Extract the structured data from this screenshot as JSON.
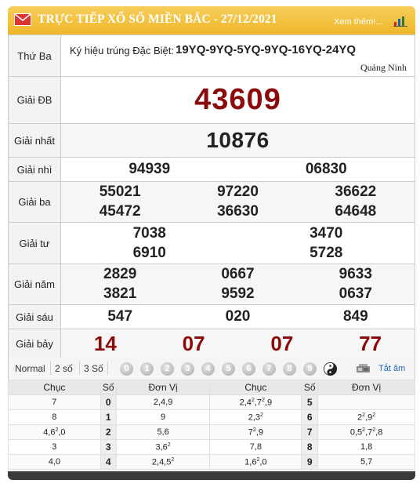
{
  "header": {
    "title": "TRỰC TIẾP XỔ SỐ MIỀN BẮC - 27/12/2021",
    "more_link": "Xem thêm!..."
  },
  "info": {
    "weekday": "Thứ Ba",
    "special_code_label": "Ký hiệu trúng Đặc Biệt:",
    "special_code": "19YQ-9YQ-5YQ-9YQ-16YQ-24YQ",
    "province": "Quảng Ninh"
  },
  "prizes": {
    "db": {
      "label": "Giải ĐB",
      "numbers": [
        "43609"
      ]
    },
    "nhat": {
      "label": "Giải nhất",
      "numbers": [
        "10876"
      ]
    },
    "nhi": {
      "label": "Giải nhì",
      "numbers": [
        "94939",
        "06830"
      ]
    },
    "ba": {
      "label": "Giải ba",
      "numbers": [
        "55021",
        "97220",
        "36622",
        "45472",
        "36630",
        "64648"
      ]
    },
    "tu": {
      "label": "Giải tư",
      "numbers": [
        "7038",
        "3470",
        "6910",
        "5728"
      ]
    },
    "nam": {
      "label": "Giải năm",
      "numbers": [
        "2829",
        "0667",
        "9633",
        "3821",
        "9592",
        "0637"
      ]
    },
    "sau": {
      "label": "Giải sáu",
      "numbers": [
        "547",
        "020",
        "849"
      ]
    },
    "bay": {
      "label": "Giải bảy",
      "numbers": [
        "14",
        "07",
        "07",
        "77"
      ]
    }
  },
  "controls": {
    "modes": [
      "Normal",
      "2 số",
      "3 Số"
    ],
    "digits": [
      "0",
      "1",
      "2",
      "3",
      "4",
      "5",
      "6",
      "7",
      "8",
      "9"
    ],
    "mute_label": "Tắt âm"
  },
  "loto": {
    "headers": [
      "Chục",
      "Số",
      "Đơn Vị",
      "Chục",
      "Số",
      "Đơn Vị"
    ],
    "rows": [
      {
        "c1": "7",
        "s1": "0",
        "d1": "2,4,9",
        "c2": "2,4<sup>2</sup>,7<sup>2</sup>,9",
        "s2": "5",
        "d2": ""
      },
      {
        "c1": "8",
        "s1": "1",
        "d1": "9",
        "c2": "2,3<sup>2</sup>",
        "s2": "6",
        "d2": "2<sup>2</sup>,9<sup>2</sup>"
      },
      {
        "c1": "4,6<sup>2</sup>,0",
        "s1": "2",
        "d1": "5,6",
        "c2": "7<sup>2</sup>,9",
        "s2": "7",
        "d2": "0,5<sup>2</sup>,7<sup>2</sup>,8"
      },
      {
        "c1": "3",
        "s1": "3",
        "d1": "3,6<sup>2</sup>",
        "c2": "7,8",
        "s2": "8",
        "d2": "1,8"
      },
      {
        "c1": "4,0",
        "s1": "4",
        "d1": "2,4,5<sup>2</sup>",
        "c2": "1,6<sup>2</sup>,0",
        "s2": "9",
        "d2": "5,7"
      }
    ]
  },
  "colors": {
    "header_bg": "#eeb62a",
    "prize_highlight": "#8b0b0b",
    "link": "#2266bb"
  }
}
